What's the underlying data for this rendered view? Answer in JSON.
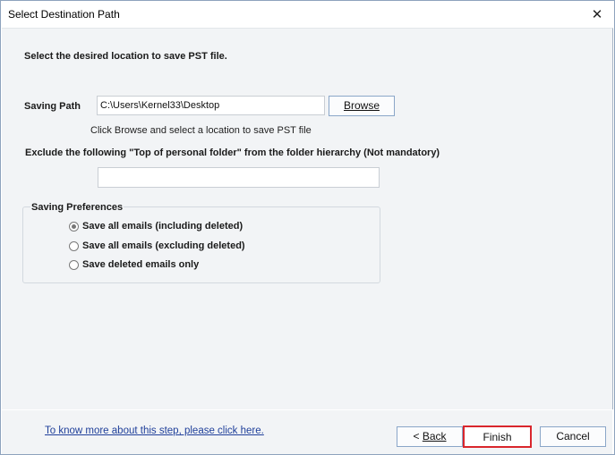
{
  "window": {
    "title": "Select Destination Path",
    "close_symbol": "✕"
  },
  "instruction": "Select the desired location to save PST file.",
  "saving_path": {
    "label": "Saving Path",
    "value": "C:\\Users\\Kernel33\\Desktop",
    "browse_label": "Browse",
    "hint": "Click Browse and select a location to save PST file"
  },
  "exclude": {
    "label": "Exclude the following \"Top of personal folder\" from the folder hierarchy  (Not mandatory)",
    "value": ""
  },
  "preferences": {
    "title": "Saving Preferences",
    "options": [
      {
        "label": "Save all emails (including deleted)",
        "checked": true
      },
      {
        "label": "Save all emails (excluding deleted)",
        "checked": false
      },
      {
        "label": "Save deleted emails only",
        "checked": false
      }
    ]
  },
  "footer": {
    "help_link": "To know more about this step, please click here.",
    "back_prefix": "< ",
    "back_label": "Back",
    "finish_label": "Finish",
    "cancel_label": "Cancel"
  },
  "colors": {
    "finish_border": "#d9262c",
    "link": "#1f3f9a",
    "panel_bg": "#f2f4f6"
  }
}
